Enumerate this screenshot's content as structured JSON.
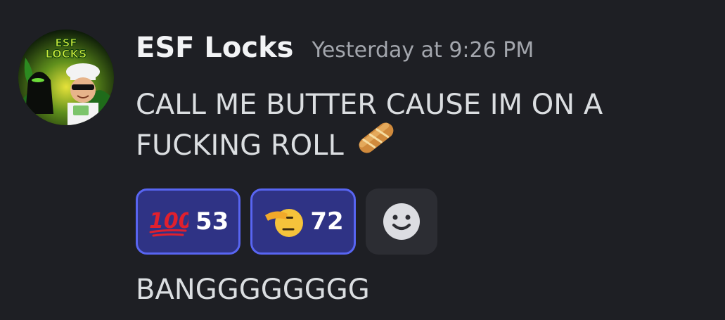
{
  "message": {
    "username": "ESF Locks",
    "timestamp": "Yesterday at 9:26 PM",
    "avatar": {
      "icon": "esf-locks-avatar",
      "text_top": "ESF",
      "text_bottom": "LOCKS"
    },
    "content_lines": [
      "CALL ME BUTTER CAUSE IM ON A",
      "FUCKING ROLL"
    ],
    "inline_emoji": "baguette-bread-emoji"
  },
  "reactions": [
    {
      "emoji": "hundred-points-emoji",
      "count": "53",
      "active": true
    },
    {
      "emoji": "saluting-face-emoji",
      "count": "72",
      "active": true
    }
  ],
  "add_reaction": {
    "icon": "smiley-face-icon"
  },
  "followup_message": "BANGGGGGGGG",
  "colors": {
    "background": "#1e1f24",
    "username": "#f2f3f5",
    "timestamp": "#a3a6ad",
    "text": "#dbdee1",
    "reaction_active_bg": "#2f3385",
    "reaction_active_border": "#5865f2",
    "add_reaction_bg": "#2c2d33"
  }
}
